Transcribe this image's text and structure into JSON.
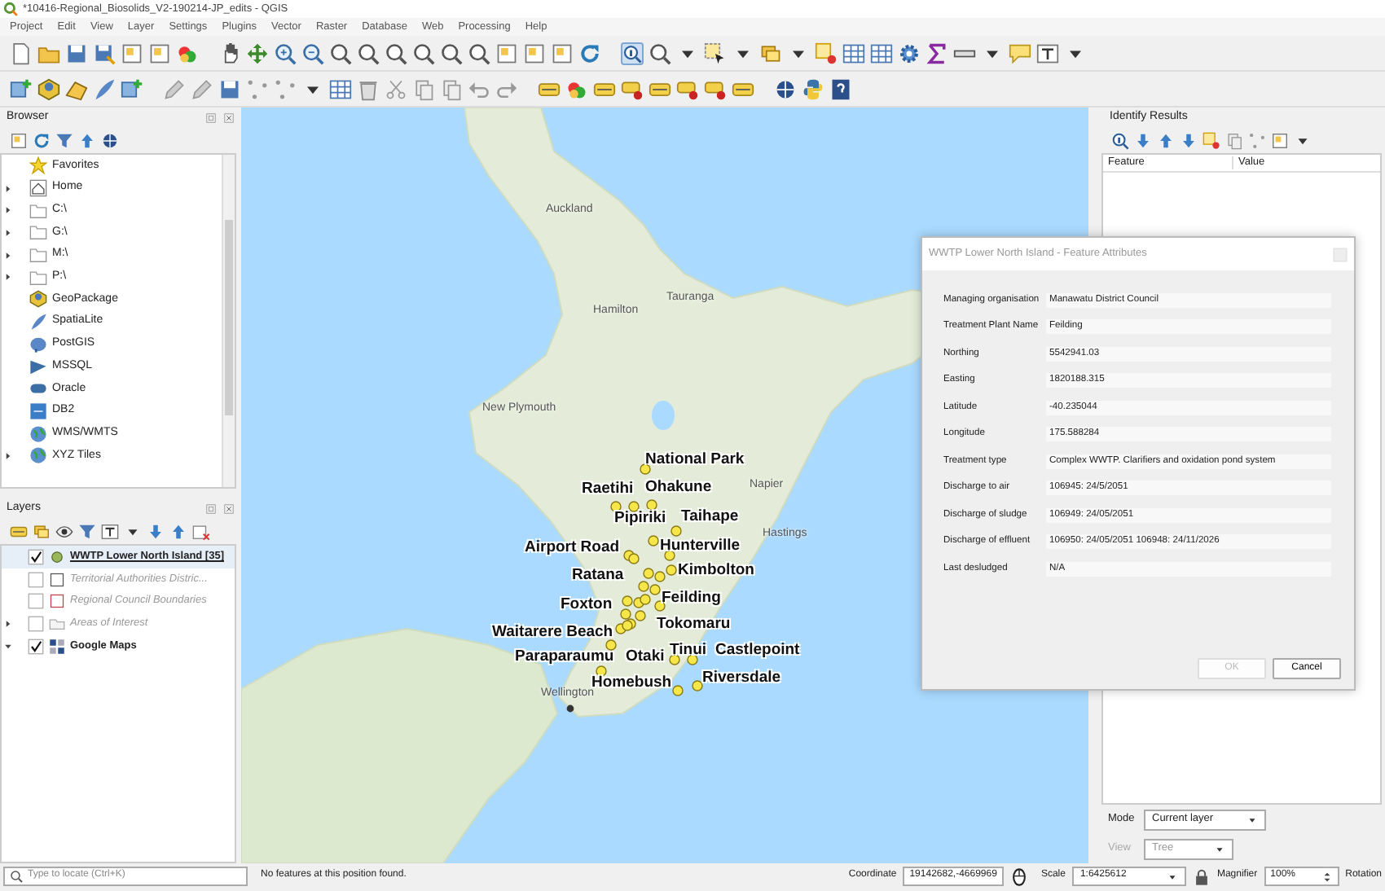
{
  "window": {
    "title": "*10416-Regional_Biosolids_V2-190214-JP_edits - QGIS"
  },
  "menu": [
    "Project",
    "Edit",
    "View",
    "Layer",
    "Settings",
    "Plugins",
    "Vector",
    "Raster",
    "Database",
    "Web",
    "Processing",
    "Help"
  ],
  "toolbar": {
    "identify_selected": true
  },
  "browser": {
    "title": "Browser",
    "items": [
      {
        "label": "Favorites",
        "expandable": false
      },
      {
        "label": "Home",
        "expandable": true
      },
      {
        "label": "C:\\",
        "expandable": true
      },
      {
        "label": "G:\\",
        "expandable": true
      },
      {
        "label": "M:\\",
        "expandable": true
      },
      {
        "label": "P:\\",
        "expandable": true
      },
      {
        "label": "GeoPackage",
        "expandable": false
      },
      {
        "label": "SpatiaLite",
        "expandable": false
      },
      {
        "label": "PostGIS",
        "expandable": false
      },
      {
        "label": "MSSQL",
        "expandable": false
      },
      {
        "label": "Oracle",
        "expandable": false
      },
      {
        "label": "DB2",
        "expandable": false
      },
      {
        "label": "WMS/WMTS",
        "expandable": false
      },
      {
        "label": "XYZ Tiles",
        "expandable": true
      }
    ]
  },
  "layers": {
    "title": "Layers",
    "items": [
      {
        "label": "WWTP Lower North Island [35]",
        "kind": "points",
        "checked": true,
        "selected": true
      },
      {
        "label": "Territorial Authorities Distric...",
        "kind": "polygon",
        "checked": false,
        "selected": false
      },
      {
        "label": "Regional Council Boundaries",
        "kind": "polygon-red",
        "checked": false,
        "selected": false
      },
      {
        "label": "Areas of Interest",
        "kind": "group",
        "checked": false,
        "selected": false,
        "expanded": false
      },
      {
        "label": "Google Maps",
        "kind": "raster",
        "checked": true,
        "selected": false,
        "expanded": true
      }
    ]
  },
  "map": {
    "places": [
      "Auckland",
      "Hamilton",
      "Tauranga",
      "New Plymouth",
      "Napier",
      "Hastings",
      "Wellington"
    ],
    "sites": [
      "National Park",
      "Raetihi",
      "Ohakune",
      "Pipiriki",
      "Taihape",
      "Airport Road",
      "Hunterville",
      "Ratana",
      "Kimbolton",
      "Foxton",
      "Feilding",
      "Waitarere Beach",
      "Tokomaru",
      "Paraparaumu",
      "Otaki",
      "Tinui",
      "Castlepoint",
      "Homebush",
      "Riversdale"
    ]
  },
  "identify": {
    "title": "Identify Results",
    "columns": [
      "Feature",
      "Value"
    ],
    "mode_label": "Mode",
    "mode": "Current layer",
    "view_label": "View",
    "view": "Tree",
    "view_disabled": true
  },
  "dialog": {
    "title": "WWTP Lower North Island - Feature Attributes",
    "fields": [
      {
        "label": "Managing organisation",
        "value": "Manawatu District Council"
      },
      {
        "label": "Treatment Plant Name",
        "value": "Feilding"
      },
      {
        "label": "Northing",
        "value": "5542941.03"
      },
      {
        "label": "Easting",
        "value": "1820188.315"
      },
      {
        "label": "Latitude",
        "value": "-40.235044"
      },
      {
        "label": "Longitude",
        "value": "175.588284"
      },
      {
        "label": "Treatment type",
        "value": "Complex WWTP. Clarifiers and oxidation pond system"
      },
      {
        "label": "Discharge to air",
        "value": "106945: 24/5/2051"
      },
      {
        "label": "Discharge of sludge",
        "value": "106949: 24/05/2051"
      },
      {
        "label": "Discharge of effluent",
        "value": "106950: 24/05/2051  106948: 24/11/2026"
      },
      {
        "label": "Last desludged",
        "value": "N/A"
      }
    ],
    "buttons": [
      {
        "label": "OK",
        "disabled": true
      },
      {
        "label": "Cancel",
        "disabled": false
      }
    ]
  },
  "status_bar": {
    "locate_placeholder": "Type to locate (Ctrl+K)",
    "message": "No features at this position found.",
    "coordinate_label": "Coordinate",
    "coordinate": "19142682,-4669969",
    "scale_label": "Scale",
    "scale": "1:6425612",
    "magnifier_label": "Magnifier",
    "magnifier": "100%",
    "rotation_label": "Rotation"
  }
}
